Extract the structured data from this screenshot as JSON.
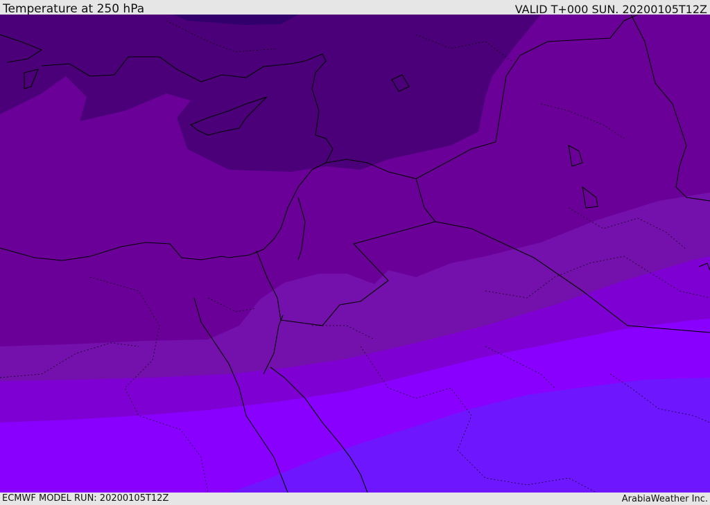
{
  "header": {
    "title": "Temperature at 250 hPa",
    "valid_time": "VALID T+000 SUN. 20200105T12Z"
  },
  "footer": {
    "model_run": "ECMWF MODEL RUN: 20200105T12Z",
    "credit": "ArabiaWeather Inc."
  },
  "map": {
    "shading_colors": [
      "#32006a",
      "#4b007a",
      "#5c008a",
      "#6a0098",
      "#7410ac",
      "#7e00d2",
      "#8a00ff",
      "#6e17ff"
    ],
    "line_color": "#000000",
    "region": "Eastern Mediterranean and Middle East",
    "shown_features": [
      "coastlines",
      "country-borders",
      "internal-borders",
      "temperature-bands"
    ]
  }
}
